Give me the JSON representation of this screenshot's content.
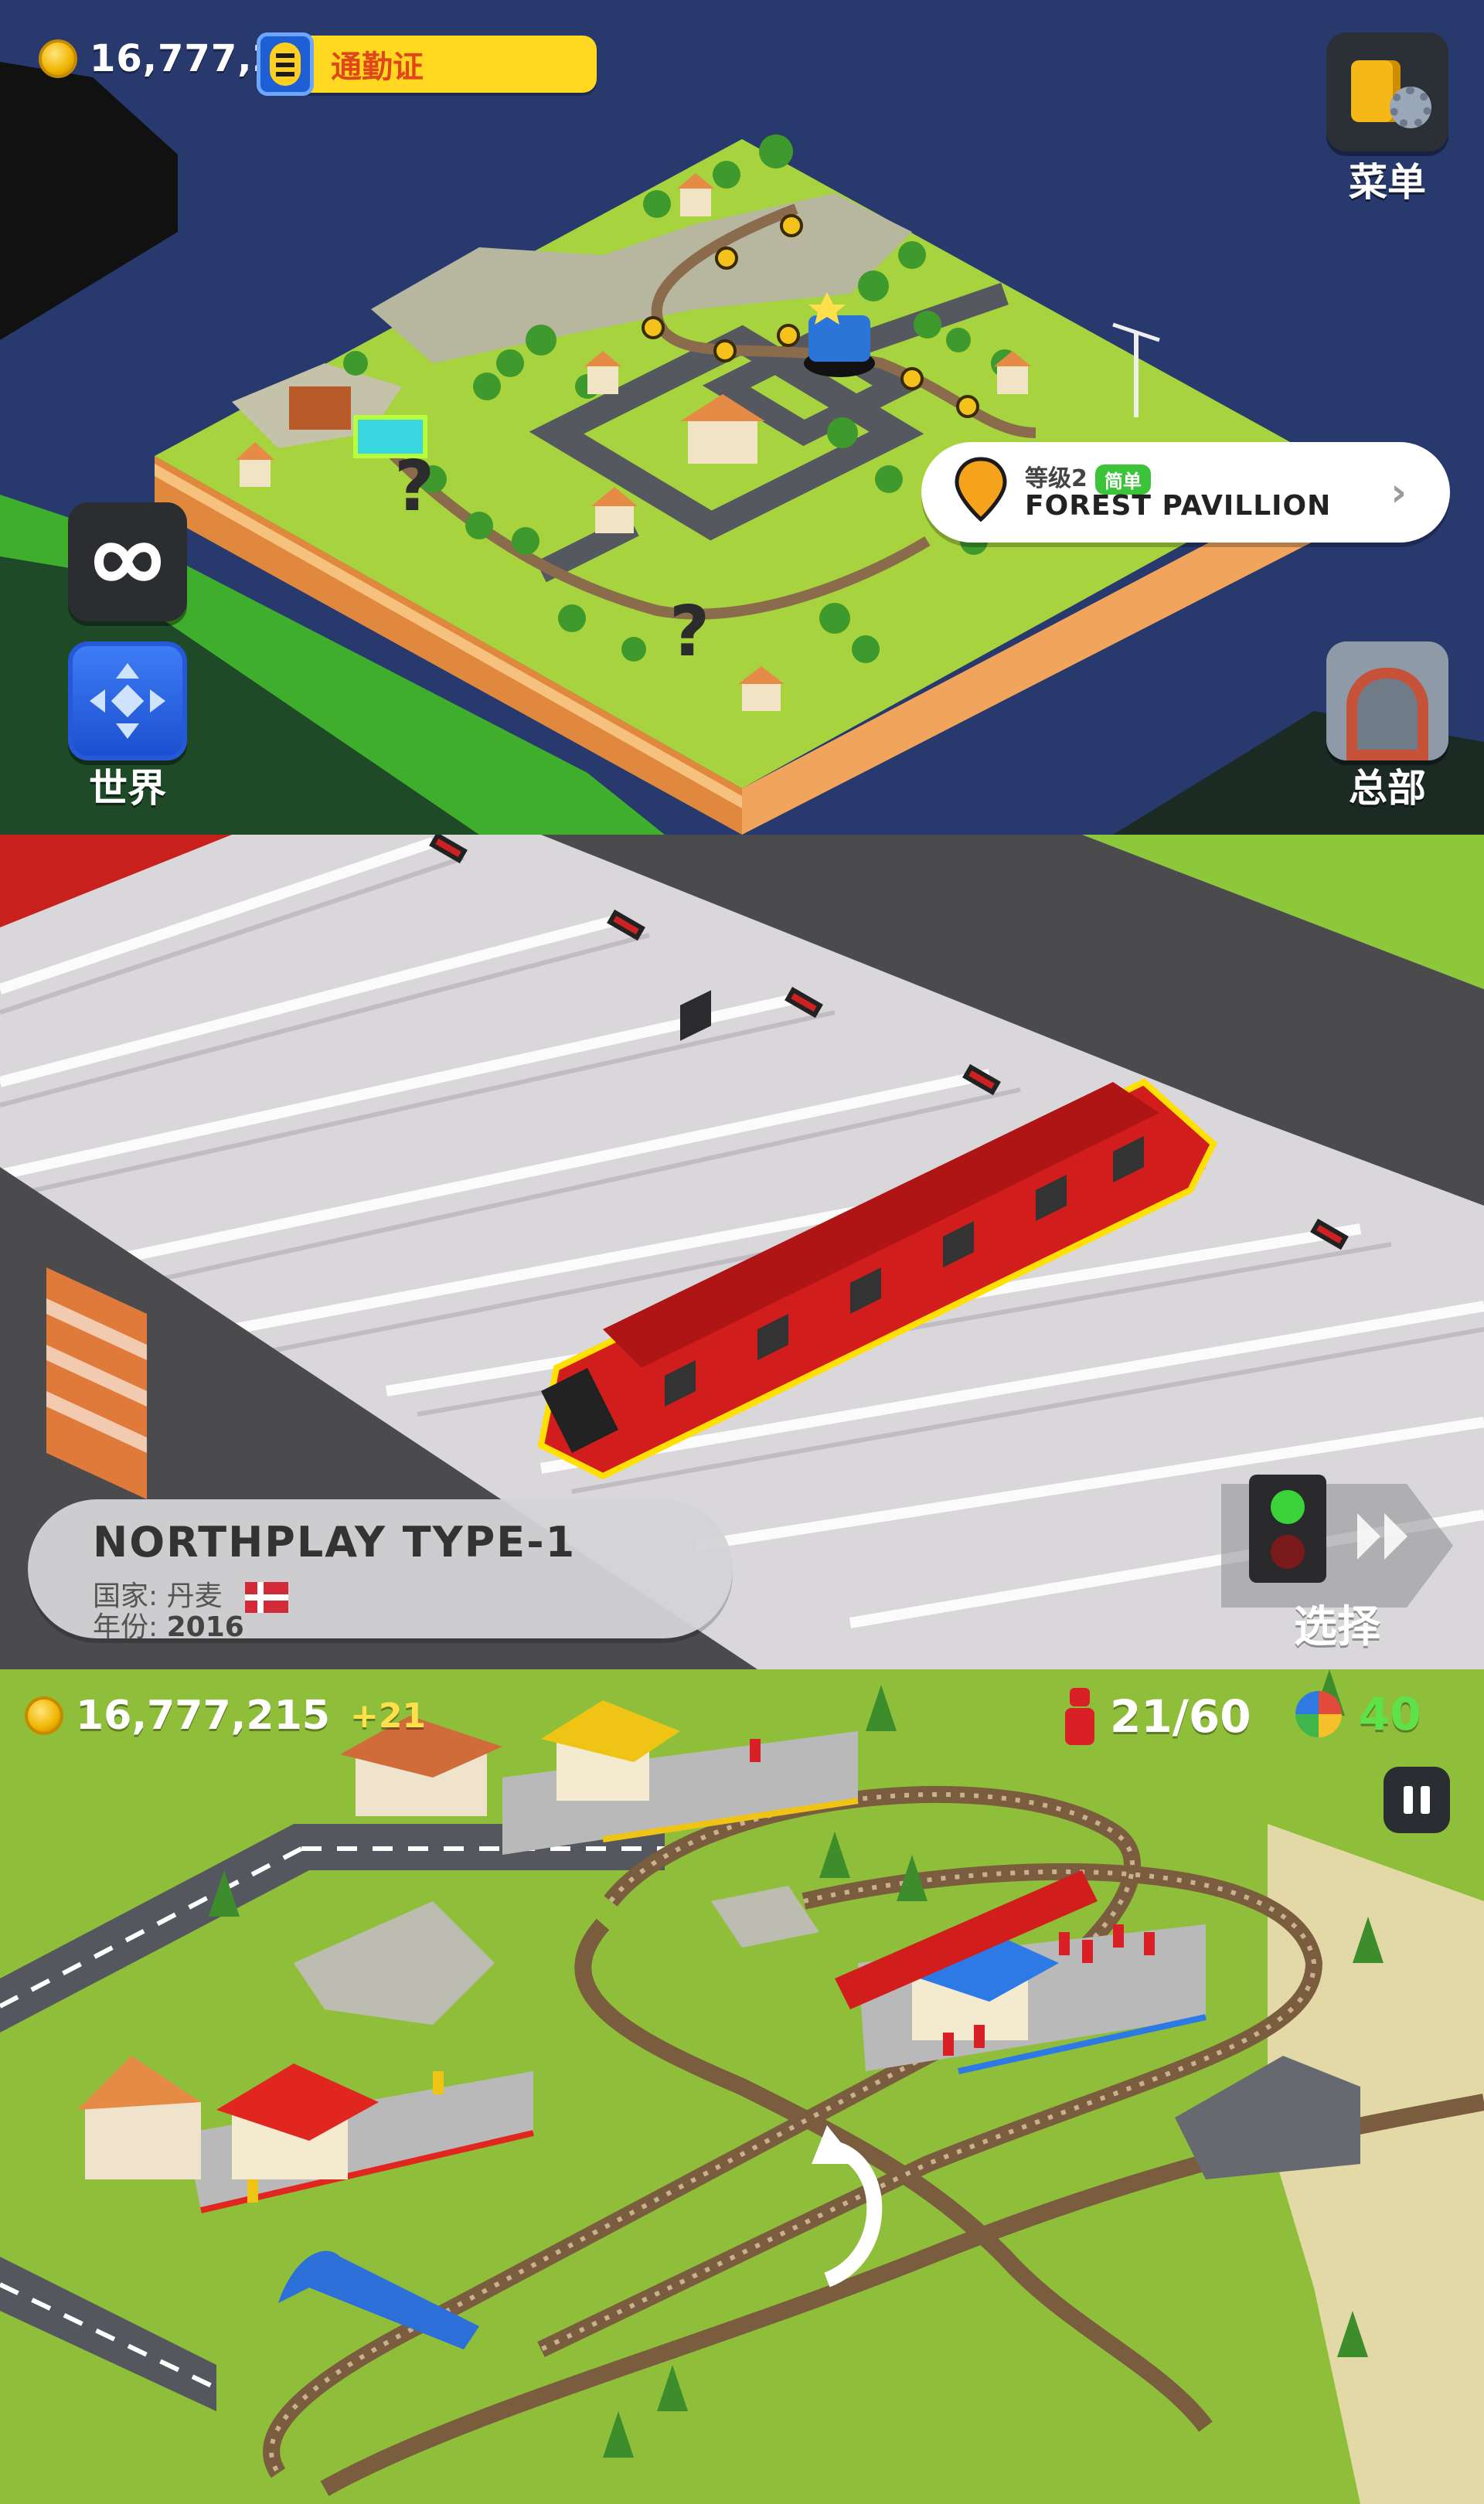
{
  "panel1": {
    "coins": "16,777,21",
    "commuter_pass": "通勤证",
    "menu_label": "菜单",
    "world_label": "世界",
    "hq_label": "总部",
    "level_card": {
      "level": "等级2",
      "difficulty": "简单",
      "name": "FOREST PAVILLION"
    },
    "colors": {
      "sky": "#28396e",
      "grass": "#9fd13a",
      "soil": "#e69a4a",
      "pass_bar": "#ffd81f"
    }
  },
  "panel2": {
    "train_name": "NORTHPLAY TYPE-1",
    "country_label": "国家:",
    "country_value": "丹麦",
    "year_label": "年份:",
    "year_value": "2016",
    "select_label": "选择",
    "colors": {
      "train": "#d21d1d",
      "platform": "#e3e1e3",
      "rails": "#cdcbcf"
    }
  },
  "panel3": {
    "coins": "16,777,215",
    "coin_gain": "+21",
    "passengers": "21/60",
    "score": "40",
    "colors": {
      "grass": "#8fbf3a",
      "road": "#54585e",
      "track": "#8a6b4c"
    }
  }
}
